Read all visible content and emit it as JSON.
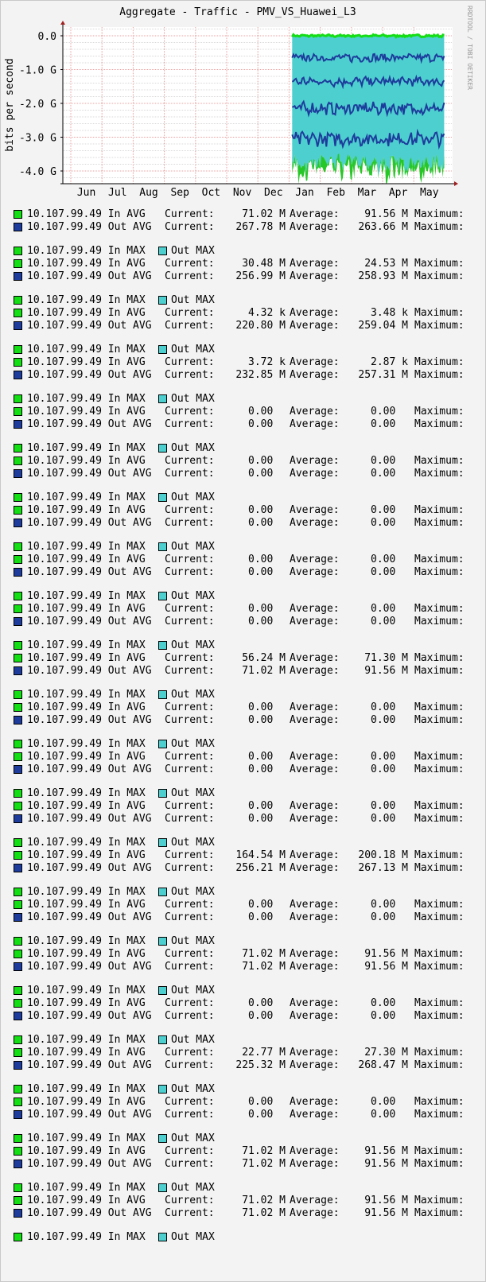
{
  "colors": {
    "in_max": "#14de14",
    "in_avg": "#28c728",
    "out_max": "#4ecfcf",
    "out_avg": "#1d3c9c",
    "grid_major": "#e8a0a0",
    "grid_minor": "#d8d8d8"
  },
  "chart_data": {
    "type": "area",
    "title": "Aggregate - Traffic - PMV_VS_Huawei_L3",
    "ylabel": "bits per second",
    "watermark": "RRDTOOL / TOBI OETIKER",
    "xlabels": [
      "Jun",
      "Jul",
      "Aug",
      "Sep",
      "Oct",
      "Nov",
      "Dec",
      "Jan",
      "Feb",
      "Mar",
      "Apr",
      "May"
    ],
    "yticks": [
      "0.0",
      "-1.0 G",
      "-2.0 G",
      "-3.0 G",
      "-4.0 G"
    ],
    "ylim": [
      -4.4,
      0.2
    ],
    "data_start_month_index": 7.1,
    "data_end_month_index": 12.0,
    "layers": [
      {
        "name": "In MAX stack",
        "color": "#14de14",
        "mean": 0.0,
        "amp": 0.03
      },
      {
        "name": "Out MAX band 1",
        "color": "#4ecfcf",
        "mean": -1.0,
        "amp": 0.12
      },
      {
        "name": "Out AVG line 1",
        "color": "#1d3c9c",
        "mean": -0.65,
        "amp": 0.1
      },
      {
        "name": "Out AVG line 2",
        "color": "#1d3c9c",
        "mean": -1.35,
        "amp": 0.12
      },
      {
        "name": "Out AVG line 3",
        "color": "#1d3c9c",
        "mean": -2.15,
        "amp": 0.15
      },
      {
        "name": "Out AVG line 4",
        "color": "#1d3c9c",
        "mean": -3.05,
        "amp": 0.18
      },
      {
        "name": "In AVG bottom",
        "color": "#28c728",
        "mean": -3.8,
        "amp": 0.25
      }
    ]
  },
  "legend": {
    "first": [
      {
        "swatch": "in",
        "label": "10.107.99.49 In AVG ",
        "cur_label": "Current:",
        "cur": "71.02 M",
        "avg_label": "Average:",
        "avg": "91.56 M",
        "max_label": "Maximum:"
      },
      {
        "swatch": "out",
        "label": "10.107.99.49 Out AVG",
        "cur_label": "Current:",
        "cur": "267.78 M",
        "avg_label": "Average:",
        "avg": "263.66 M",
        "max_label": "Maximum:"
      }
    ],
    "groups": [
      {
        "max": {
          "in_label": "10.107.99.49 In MAX",
          "out_label": "Out MAX"
        },
        "rows": [
          {
            "label": "10.107.99.49 In AVG ",
            "cur_label": "Current:",
            "cur": "30.48 M",
            "avg_label": "Average:",
            "avg": "24.53 M",
            "max_label": "Maximum:"
          },
          {
            "label": "10.107.99.49 Out AVG",
            "cur_label": "Current:",
            "cur": "256.99 M",
            "avg_label": "Average:",
            "avg": "258.93 M",
            "max_label": "Maximum:"
          }
        ]
      },
      {
        "max": {
          "in_label": "10.107.99.49 In MAX",
          "out_label": "Out MAX"
        },
        "rows": [
          {
            "label": "10.107.99.49 In AVG ",
            "cur_label": "Current:",
            "cur": "4.32 k",
            "avg_label": "Average:",
            "avg": "3.48 k",
            "max_label": "Maximum:"
          },
          {
            "label": "10.107.99.49 Out AVG",
            "cur_label": "Current:",
            "cur": "220.80 M",
            "avg_label": "Average:",
            "avg": "259.04 M",
            "max_label": "Maximum:"
          }
        ]
      },
      {
        "max": {
          "in_label": "10.107.99.49 In MAX",
          "out_label": "Out MAX"
        },
        "rows": [
          {
            "label": "10.107.99.49 In AVG ",
            "cur_label": "Current:",
            "cur": "3.72 k",
            "avg_label": "Average:",
            "avg": "2.87 k",
            "max_label": "Maximum:"
          },
          {
            "label": "10.107.99.49 Out AVG",
            "cur_label": "Current:",
            "cur": "232.85 M",
            "avg_label": "Average:",
            "avg": "257.31 M",
            "max_label": "Maximum:"
          }
        ]
      },
      {
        "max": {
          "in_label": "10.107.99.49 In MAX",
          "out_label": "Out MAX"
        },
        "rows": [
          {
            "label": "10.107.99.49 In AVG ",
            "cur_label": "Current:",
            "cur": "0.00  ",
            "avg_label": "Average:",
            "avg": "0.00  ",
            "max_label": "Maximum:"
          },
          {
            "label": "10.107.99.49 Out AVG",
            "cur_label": "Current:",
            "cur": "0.00  ",
            "avg_label": "Average:",
            "avg": "0.00  ",
            "max_label": "Maximum:"
          }
        ]
      },
      {
        "max": {
          "in_label": "10.107.99.49 In MAX",
          "out_label": "Out MAX"
        },
        "rows": [
          {
            "label": "10.107.99.49 In AVG ",
            "cur_label": "Current:",
            "cur": "0.00  ",
            "avg_label": "Average:",
            "avg": "0.00  ",
            "max_label": "Maximum:"
          },
          {
            "label": "10.107.99.49 Out AVG",
            "cur_label": "Current:",
            "cur": "0.00  ",
            "avg_label": "Average:",
            "avg": "0.00  ",
            "max_label": "Maximum:"
          }
        ]
      },
      {
        "max": {
          "in_label": "10.107.99.49 In MAX",
          "out_label": "Out MAX"
        },
        "rows": [
          {
            "label": "10.107.99.49 In AVG ",
            "cur_label": "Current:",
            "cur": "0.00  ",
            "avg_label": "Average:",
            "avg": "0.00  ",
            "max_label": "Maximum:"
          },
          {
            "label": "10.107.99.49 Out AVG",
            "cur_label": "Current:",
            "cur": "0.00  ",
            "avg_label": "Average:",
            "avg": "0.00  ",
            "max_label": "Maximum:"
          }
        ]
      },
      {
        "max": {
          "in_label": "10.107.99.49 In MAX",
          "out_label": "Out MAX"
        },
        "rows": [
          {
            "label": "10.107.99.49 In AVG ",
            "cur_label": "Current:",
            "cur": "0.00  ",
            "avg_label": "Average:",
            "avg": "0.00  ",
            "max_label": "Maximum:"
          },
          {
            "label": "10.107.99.49 Out AVG",
            "cur_label": "Current:",
            "cur": "0.00  ",
            "avg_label": "Average:",
            "avg": "0.00  ",
            "max_label": "Maximum:"
          }
        ]
      },
      {
        "max": {
          "in_label": "10.107.99.49 In MAX",
          "out_label": "Out MAX"
        },
        "rows": [
          {
            "label": "10.107.99.49 In AVG ",
            "cur_label": "Current:",
            "cur": "0.00  ",
            "avg_label": "Average:",
            "avg": "0.00  ",
            "max_label": "Maximum:"
          },
          {
            "label": "10.107.99.49 Out AVG",
            "cur_label": "Current:",
            "cur": "0.00  ",
            "avg_label": "Average:",
            "avg": "0.00  ",
            "max_label": "Maximum:"
          }
        ]
      },
      {
        "max": {
          "in_label": "10.107.99.49 In MAX",
          "out_label": "Out MAX"
        },
        "rows": [
          {
            "label": "10.107.99.49 In AVG ",
            "cur_label": "Current:",
            "cur": "56.24 M",
            "avg_label": "Average:",
            "avg": "71.30 M",
            "max_label": "Maximum:"
          },
          {
            "label": "10.107.99.49 Out AVG",
            "cur_label": "Current:",
            "cur": "71.02 M",
            "avg_label": "Average:",
            "avg": "91.56 M",
            "max_label": "Maximum:"
          }
        ]
      },
      {
        "max": {
          "in_label": "10.107.99.49 In MAX",
          "out_label": "Out MAX"
        },
        "rows": [
          {
            "label": "10.107.99.49 In AVG ",
            "cur_label": "Current:",
            "cur": "0.00  ",
            "avg_label": "Average:",
            "avg": "0.00  ",
            "max_label": "Maximum:"
          },
          {
            "label": "10.107.99.49 Out AVG",
            "cur_label": "Current:",
            "cur": "0.00  ",
            "avg_label": "Average:",
            "avg": "0.00  ",
            "max_label": "Maximum:"
          }
        ]
      },
      {
        "max": {
          "in_label": "10.107.99.49 In MAX",
          "out_label": "Out MAX"
        },
        "rows": [
          {
            "label": "10.107.99.49 In AVG ",
            "cur_label": "Current:",
            "cur": "0.00  ",
            "avg_label": "Average:",
            "avg": "0.00  ",
            "max_label": "Maximum:"
          },
          {
            "label": "10.107.99.49 Out AVG",
            "cur_label": "Current:",
            "cur": "0.00  ",
            "avg_label": "Average:",
            "avg": "0.00  ",
            "max_label": "Maximum:"
          }
        ]
      },
      {
        "max": {
          "in_label": "10.107.99.49 In MAX",
          "out_label": "Out MAX"
        },
        "rows": [
          {
            "label": "10.107.99.49 In AVG ",
            "cur_label": "Current:",
            "cur": "0.00  ",
            "avg_label": "Average:",
            "avg": "0.00  ",
            "max_label": "Maximum:"
          },
          {
            "label": "10.107.99.49 Out AVG",
            "cur_label": "Current:",
            "cur": "0.00  ",
            "avg_label": "Average:",
            "avg": "0.00  ",
            "max_label": "Maximum:"
          }
        ]
      },
      {
        "max": {
          "in_label": "10.107.99.49 In MAX",
          "out_label": "Out MAX"
        },
        "rows": [
          {
            "label": "10.107.99.49 In AVG ",
            "cur_label": "Current:",
            "cur": "164.54 M",
            "avg_label": "Average:",
            "avg": "200.18 M",
            "max_label": "Maximum:"
          },
          {
            "label": "10.107.99.49 Out AVG",
            "cur_label": "Current:",
            "cur": "256.21 M",
            "avg_label": "Average:",
            "avg": "267.13 M",
            "max_label": "Maximum:"
          }
        ]
      },
      {
        "max": {
          "in_label": "10.107.99.49 In MAX",
          "out_label": "Out MAX"
        },
        "rows": [
          {
            "label": "10.107.99.49 In AVG ",
            "cur_label": "Current:",
            "cur": "0.00  ",
            "avg_label": "Average:",
            "avg": "0.00  ",
            "max_label": "Maximum:"
          },
          {
            "label": "10.107.99.49 Out AVG",
            "cur_label": "Current:",
            "cur": "0.00  ",
            "avg_label": "Average:",
            "avg": "0.00  ",
            "max_label": "Maximum:"
          }
        ]
      },
      {
        "max": {
          "in_label": "10.107.99.49 In MAX",
          "out_label": "Out MAX"
        },
        "rows": [
          {
            "label": "10.107.99.49 In AVG ",
            "cur_label": "Current:",
            "cur": "71.02 M",
            "avg_label": "Average:",
            "avg": "91.56 M",
            "max_label": "Maximum:"
          },
          {
            "label": "10.107.99.49 Out AVG",
            "cur_label": "Current:",
            "cur": "71.02 M",
            "avg_label": "Average:",
            "avg": "91.56 M",
            "max_label": "Maximum:"
          }
        ]
      },
      {
        "max": {
          "in_label": "10.107.99.49 In MAX",
          "out_label": "Out MAX"
        },
        "rows": [
          {
            "label": "10.107.99.49 In AVG ",
            "cur_label": "Current:",
            "cur": "0.00  ",
            "avg_label": "Average:",
            "avg": "0.00  ",
            "max_label": "Maximum:"
          },
          {
            "label": "10.107.99.49 Out AVG",
            "cur_label": "Current:",
            "cur": "0.00  ",
            "avg_label": "Average:",
            "avg": "0.00  ",
            "max_label": "Maximum:"
          }
        ]
      },
      {
        "max": {
          "in_label": "10.107.99.49 In MAX",
          "out_label": "Out MAX"
        },
        "rows": [
          {
            "label": "10.107.99.49 In AVG ",
            "cur_label": "Current:",
            "cur": "22.77 M",
            "avg_label": "Average:",
            "avg": "27.30 M",
            "max_label": "Maximum:"
          },
          {
            "label": "10.107.99.49 Out AVG",
            "cur_label": "Current:",
            "cur": "225.32 M",
            "avg_label": "Average:",
            "avg": "268.47 M",
            "max_label": "Maximum:"
          }
        ]
      },
      {
        "max": {
          "in_label": "10.107.99.49 In MAX",
          "out_label": "Out MAX"
        },
        "rows": [
          {
            "label": "10.107.99.49 In AVG ",
            "cur_label": "Current:",
            "cur": "0.00  ",
            "avg_label": "Average:",
            "avg": "0.00  ",
            "max_label": "Maximum:"
          },
          {
            "label": "10.107.99.49 Out AVG",
            "cur_label": "Current:",
            "cur": "0.00  ",
            "avg_label": "Average:",
            "avg": "0.00  ",
            "max_label": "Maximum:"
          }
        ]
      },
      {
        "max": {
          "in_label": "10.107.99.49 In MAX",
          "out_label": "Out MAX"
        },
        "rows": [
          {
            "label": "10.107.99.49 In AVG ",
            "cur_label": "Current:",
            "cur": "71.02 M",
            "avg_label": "Average:",
            "avg": "91.56 M",
            "max_label": "Maximum:"
          },
          {
            "label": "10.107.99.49 Out AVG",
            "cur_label": "Current:",
            "cur": "71.02 M",
            "avg_label": "Average:",
            "avg": "91.56 M",
            "max_label": "Maximum:"
          }
        ]
      },
      {
        "max": {
          "in_label": "10.107.99.49 In MAX",
          "out_label": "Out MAX"
        },
        "rows": [
          {
            "label": "10.107.99.49 In AVG ",
            "cur_label": "Current:",
            "cur": "71.02 M",
            "avg_label": "Average:",
            "avg": "91.56 M",
            "max_label": "Maximum:"
          },
          {
            "label": "10.107.99.49 Out AVG",
            "cur_label": "Current:",
            "cur": "71.02 M",
            "avg_label": "Average:",
            "avg": "91.56 M",
            "max_label": "Maximum:"
          }
        ]
      }
    ],
    "last_max": {
      "in_label": "10.107.99.49 In MAX",
      "out_label": "Out MAX"
    }
  }
}
